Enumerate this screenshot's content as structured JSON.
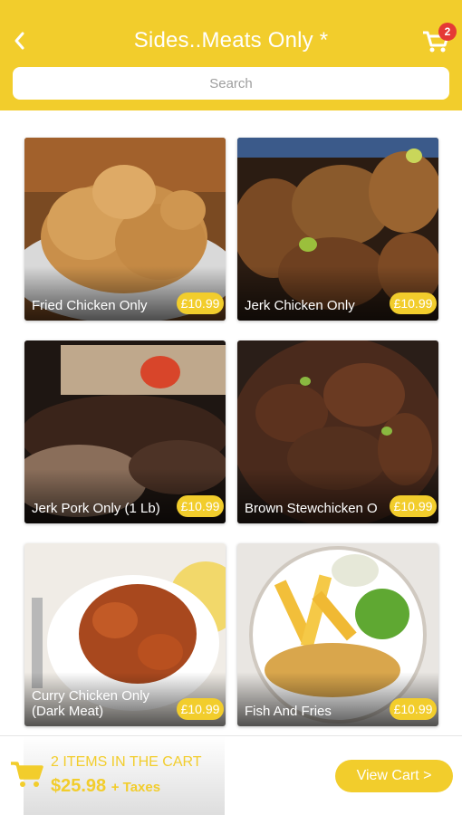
{
  "header": {
    "title": "Sides..Meats Only *",
    "cart_count": "2",
    "search_placeholder": "Search"
  },
  "items": [
    {
      "name": "Fried Chicken Only",
      "price": "£10.99",
      "image_icon": "fried-chicken-image"
    },
    {
      "name": "Jerk Chicken Only",
      "price": "£10.99",
      "image_icon": "jerk-chicken-image"
    },
    {
      "name": "Jerk Pork Only (1 Lb)",
      "price": "£10.99",
      "image_icon": "jerk-pork-image"
    },
    {
      "name": "Brown Stewchicken O",
      "price": "£10.99",
      "image_icon": "brown-stewchicken-image"
    },
    {
      "name": "Curry Chicken Only (Dark Meat)",
      "price": "£10.99",
      "image_icon": "curry-chicken-image"
    },
    {
      "name": "Fish And Fries",
      "price": "£10.99",
      "image_icon": "fish-and-fries-image"
    }
  ],
  "footer": {
    "items_in_cart": "2 ITEMS IN THE CART",
    "total": "$25.98",
    "taxes": "+ Taxes",
    "view_cart": "View Cart >"
  },
  "colors": {
    "accent": "#f2cd2c",
    "badge": "#e53935"
  }
}
